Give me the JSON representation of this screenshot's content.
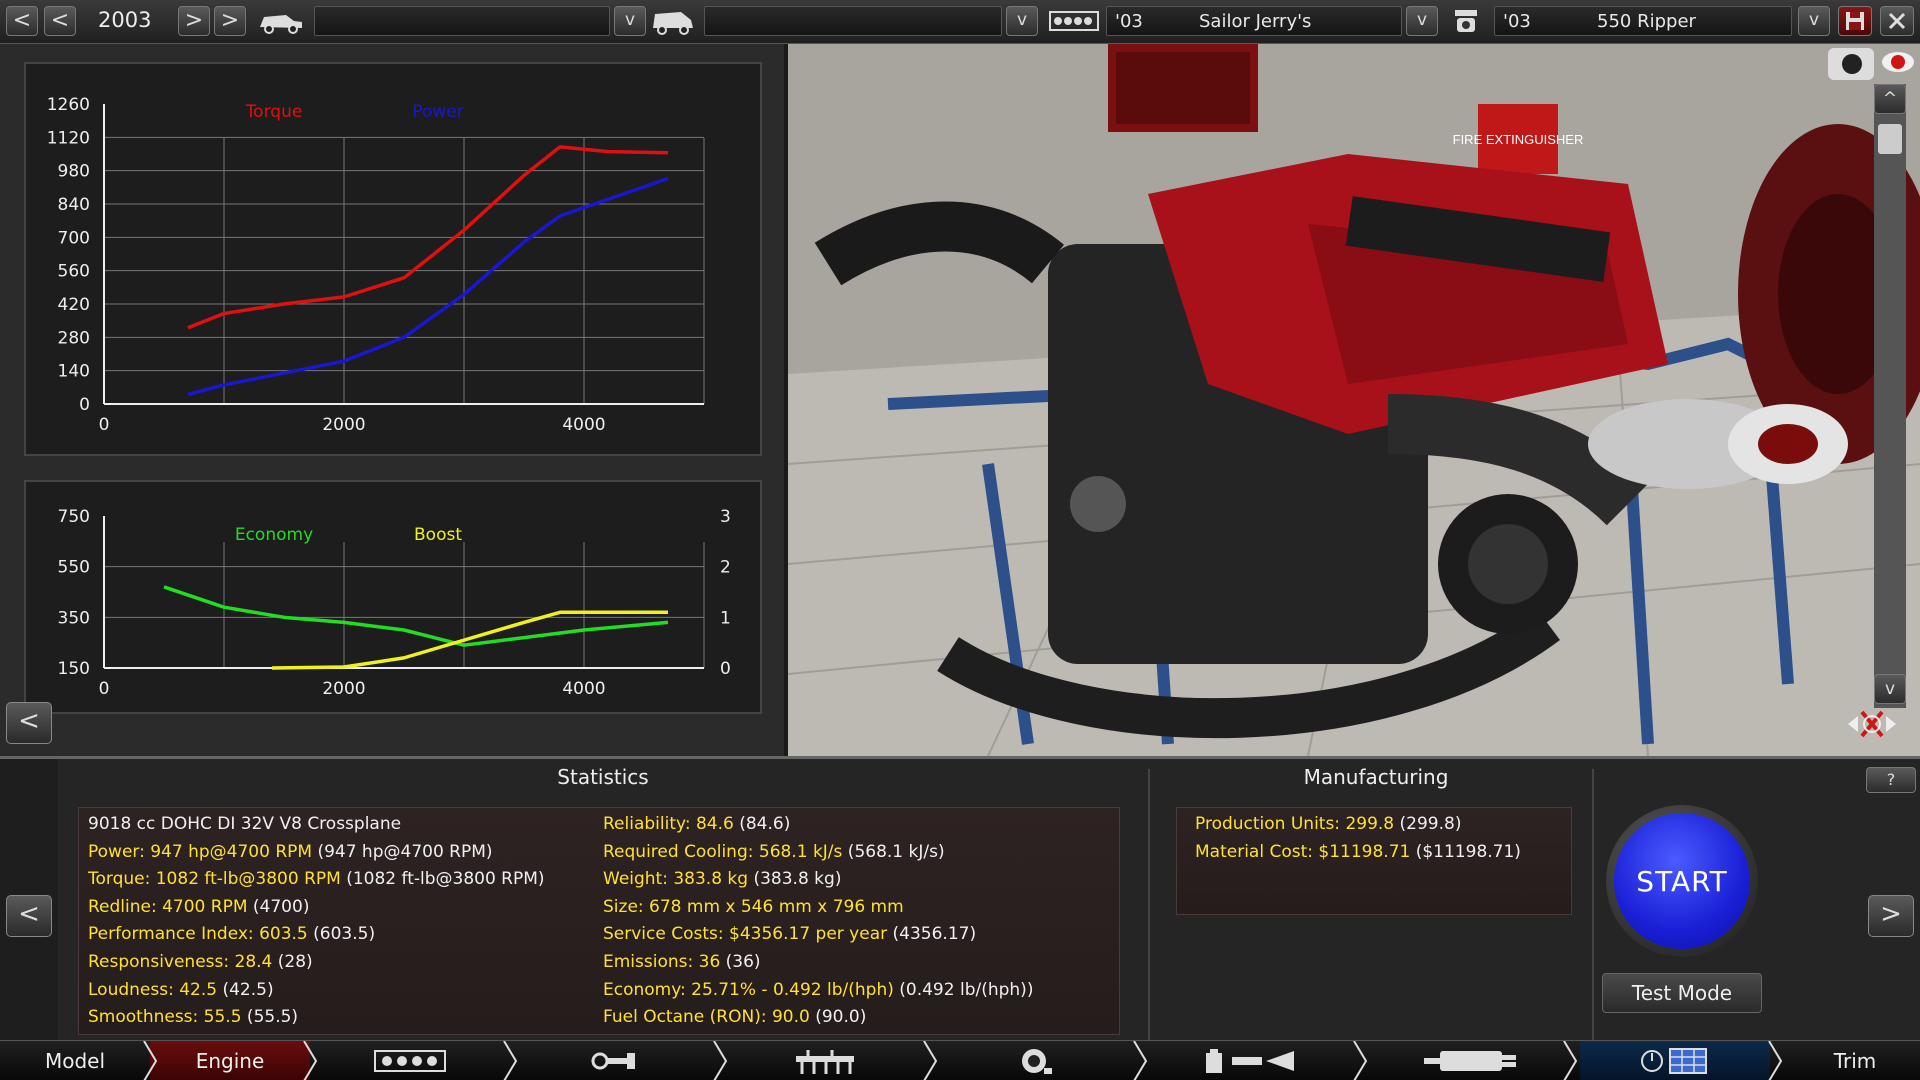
{
  "topbar": {
    "year": "2003",
    "engine_family_year": "'03",
    "engine_family_name": "Sailor Jerry's",
    "variant_year": "'03",
    "variant_name": "550 Ripper",
    "prev": "<",
    "next": ">",
    "dropdown": "v"
  },
  "graphs": {
    "top": {
      "legend_torque": "Torque",
      "legend_power": "Power",
      "y_ticks": [
        "1260",
        "1120",
        "980",
        "840",
        "700",
        "560",
        "420",
        "280",
        "140",
        "0"
      ],
      "x_ticks": [
        "0",
        "2000",
        "4000"
      ]
    },
    "bottom": {
      "legend_economy": "Economy",
      "legend_boost": "Boost",
      "y_ticks_left": [
        "750",
        "550",
        "350",
        "150"
      ],
      "y_ticks_right": [
        "3",
        "2",
        "1",
        "0"
      ],
      "x_ticks": [
        "0",
        "2000",
        "4000"
      ]
    },
    "back_button": "<"
  },
  "chart_data": [
    {
      "type": "line",
      "series": [
        {
          "name": "Torque",
          "color": "#e01010",
          "x": [
            700,
            1000,
            1500,
            2000,
            2500,
            3000,
            3500,
            3800,
            4200,
            4700
          ],
          "y": [
            320,
            380,
            420,
            450,
            530,
            730,
            960,
            1080,
            1060,
            1055
          ]
        },
        {
          "name": "Power",
          "color": "#1818d0",
          "x": [
            700,
            1000,
            1500,
            2000,
            2500,
            3000,
            3500,
            3800,
            4200,
            4700
          ],
          "y": [
            40,
            80,
            130,
            180,
            280,
            460,
            680,
            790,
            860,
            947
          ]
        }
      ],
      "xlim": [
        0,
        5000
      ],
      "ylim": [
        0,
        1260
      ],
      "grid": true
    },
    {
      "type": "line",
      "series": [
        {
          "name": "Economy",
          "axis": "left",
          "color": "#22dd22",
          "x": [
            500,
            1000,
            1500,
            2000,
            2500,
            3000,
            3500,
            4000,
            4700
          ],
          "y": [
            470,
            390,
            350,
            330,
            300,
            240,
            270,
            300,
            330
          ]
        },
        {
          "name": "Boost",
          "axis": "right",
          "color": "#f0f020",
          "x": [
            1400,
            2000,
            2500,
            3000,
            3500,
            3800,
            4200,
            4700
          ],
          "y": [
            0,
            0.02,
            0.2,
            0.55,
            0.9,
            1.1,
            1.1,
            1.1
          ]
        }
      ],
      "xlim": [
        0,
        5000
      ],
      "ylim_left": [
        150,
        750
      ],
      "ylim_right": [
        0,
        3
      ],
      "grid": true
    }
  ],
  "view3d": {
    "sign_text": "FIRE EXTINGUISHER",
    "scroll_up": "^",
    "scroll_down": "v"
  },
  "statistics": {
    "title": "Statistics",
    "left": [
      {
        "k": "",
        "v": "9018 cc DOHC DI 32V V8 Crossplane",
        "white": true
      },
      {
        "k": "Power: 947 hp@4700 RPM",
        "v": " (947 hp@4700 RPM)"
      },
      {
        "k": "Torque: 1082 ft-lb@3800 RPM",
        "v": " (1082 ft-lb@3800 RPM)"
      },
      {
        "k": "Redline: 4700 RPM",
        "v": " (4700)"
      },
      {
        "k": "Performance Index: 603.5",
        "v": " (603.5)"
      },
      {
        "k": "Responsiveness: 28.4",
        "v": " (28)"
      },
      {
        "k": "Loudness: 42.5",
        "v": " (42.5)"
      },
      {
        "k": "Smoothness: 55.5",
        "v": " (55.5)"
      }
    ],
    "right": [
      {
        "k": "Reliability: 84.6",
        "v": " (84.6)"
      },
      {
        "k": "Required Cooling: 568.1 kJ/s",
        "v": " (568.1 kJ/s)"
      },
      {
        "k": "Weight: 383.8 kg",
        "v": " (383.8 kg)"
      },
      {
        "k": "Size: 678 mm x 546 mm x 796 mm",
        "v": ""
      },
      {
        "k": "Service Costs: $4356.17 per year",
        "v": " (4356.17)"
      },
      {
        "k": "Emissions: 36",
        "v": " (36)"
      },
      {
        "k": "Economy: 25.71% - 0.492 lb/(hph)",
        "v": " (0.492 lb/(hph))"
      },
      {
        "k": "Fuel Octane (RON): 90.0",
        "v": " (90.0)"
      }
    ]
  },
  "manufacturing": {
    "title": "Manufacturing",
    "rows": [
      {
        "k": "Production Units: 299.8",
        "v": " (299.8)"
      },
      {
        "k": "Material Cost: $11198.71",
        "v": " ($11198.71)"
      }
    ]
  },
  "actions": {
    "help": "?",
    "start": "START",
    "test_mode": "Test Mode",
    "left_arrow": "<",
    "right_arrow": ">"
  },
  "nav": {
    "model": "Model",
    "engine": "Engine",
    "trim": "Trim"
  }
}
